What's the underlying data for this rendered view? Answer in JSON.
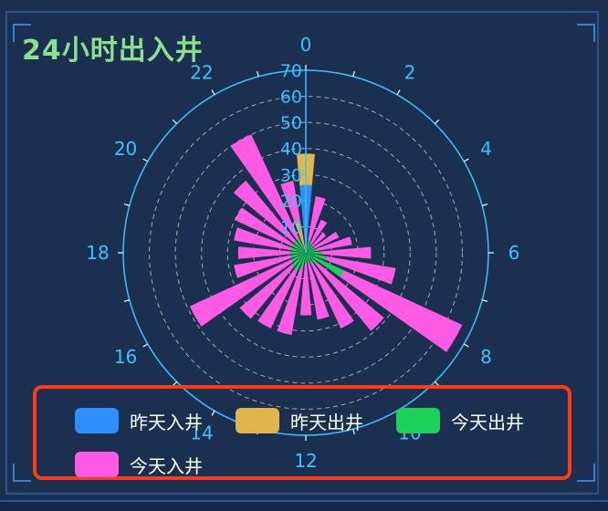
{
  "title": "24小时出入井",
  "colors": {
    "yesterday_in": "#2f8fff",
    "yesterday_out": "#e0b54a",
    "today_out": "#1ed15a",
    "today_in": "#ff5ae6",
    "axis": "#3fc1ff",
    "grid": "#c8c8c8"
  },
  "chart_data": {
    "type": "polar-bar-stacked",
    "title": "24小时出入井",
    "angle_axis": {
      "categories": [
        "0",
        "1",
        "2",
        "3",
        "4",
        "5",
        "6",
        "7",
        "8",
        "9",
        "10",
        "11",
        "12",
        "13",
        "14",
        "15",
        "16",
        "17",
        "18",
        "19",
        "20",
        "21",
        "22",
        "23"
      ],
      "labels_shown": [
        "0",
        "2",
        "4",
        "6",
        "8",
        "10",
        "12",
        "14",
        "16",
        "18",
        "20",
        "22"
      ]
    },
    "radius_axis": {
      "min": 0,
      "max": 70,
      "ticks": [
        "0",
        "10",
        "20",
        "30",
        "40",
        "50",
        "60",
        "70"
      ]
    },
    "series": [
      {
        "name": "昨天入井",
        "values": [
          26,
          0,
          0,
          0,
          0,
          0,
          0,
          0,
          0,
          0,
          0,
          0,
          0,
          0,
          0,
          0,
          0,
          0,
          0,
          0,
          0,
          0,
          0,
          0
        ]
      },
      {
        "name": "昨天出井",
        "values": [
          12,
          0,
          0,
          0,
          0,
          0,
          0,
          0,
          0,
          0,
          0,
          0,
          0,
          0,
          0,
          0,
          0,
          0,
          0,
          0,
          0,
          0,
          0,
          12
        ]
      },
      {
        "name": "今天出井",
        "values": [
          0,
          5,
          4,
          3,
          4,
          4,
          6,
          8,
          16,
          6,
          4,
          4,
          4,
          6,
          8,
          7,
          6,
          6,
          6,
          6,
          6,
          6,
          6,
          0
        ]
      },
      {
        "name": "今天入井",
        "values": [
          0,
          17,
          10,
          7,
          10,
          14,
          19,
          27,
          50,
          33,
          28,
          22,
          20,
          26,
          24,
          26,
          43,
          22,
          20,
          22,
          24,
          30,
          44,
          16
        ]
      }
    ],
    "legend": {
      "position": "bottom",
      "items": [
        {
          "label": "昨天入井",
          "color": "#2f8fff"
        },
        {
          "label": "昨天出井",
          "color": "#e0b54a"
        },
        {
          "label": "今天出井",
          "color": "#1ed15a"
        },
        {
          "label": "今天入井",
          "color": "#ff5ae6"
        }
      ]
    },
    "grid": true
  }
}
